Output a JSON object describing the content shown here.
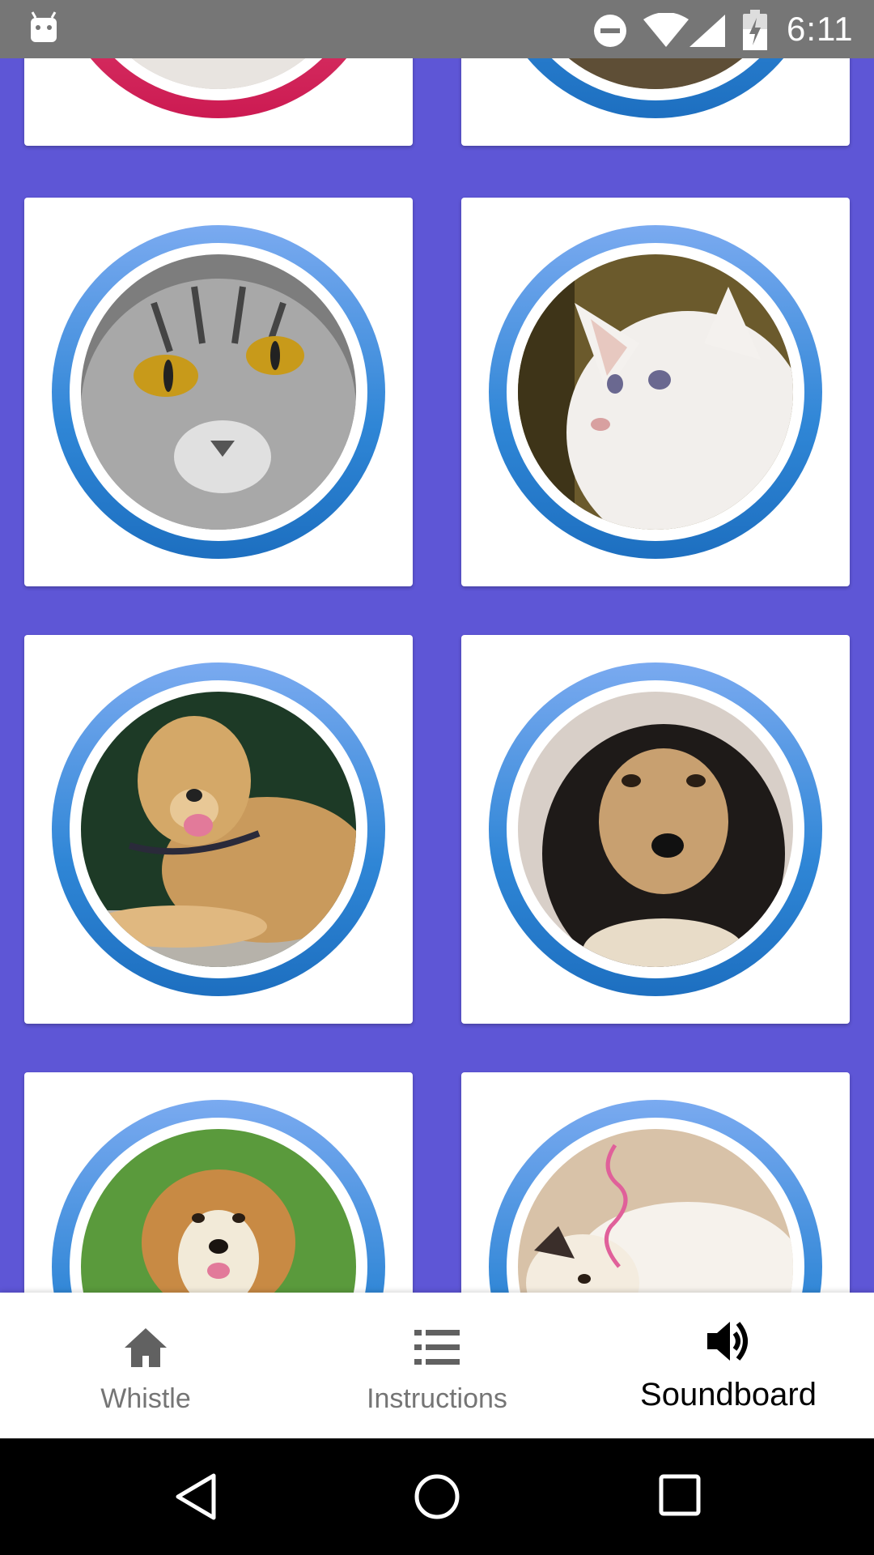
{
  "status_bar": {
    "time": "6:11",
    "icons": [
      "android-icon",
      "do-not-disturb-icon",
      "wifi-icon",
      "cell-signal-icon",
      "battery-charging-icon"
    ]
  },
  "grid": {
    "cards": [
      {
        "animal": "cat",
        "ring_color": "#cc1a52"
      },
      {
        "animal": "dog",
        "ring_color": "#1d6fc0"
      },
      {
        "animal": "gray-tabby-cat",
        "ring_color": "#1d6fc0"
      },
      {
        "animal": "white-kitten",
        "ring_color": "#1d6fc0"
      },
      {
        "animal": "golden-retriever",
        "ring_color": "#1d6fc0"
      },
      {
        "animal": "black-tan-dog",
        "ring_color": "#1d6fc0"
      },
      {
        "animal": "fluffy-dog-on-grass",
        "ring_color": "#1d6fc0"
      },
      {
        "animal": "kitten-with-ribbon",
        "ring_color": "#1d6fc0"
      }
    ]
  },
  "bottom_nav": {
    "items": [
      {
        "label": "Whistle",
        "icon": "home-icon",
        "active": false
      },
      {
        "label": "Instructions",
        "icon": "list-icon",
        "active": false
      },
      {
        "label": "Soundboard",
        "icon": "volume-icon",
        "active": true
      }
    ]
  },
  "colors": {
    "background": "#5e56d6",
    "status_bar": "#767676",
    "ring_blue": "#2f86d6",
    "ring_pink": "#cc1a52"
  }
}
